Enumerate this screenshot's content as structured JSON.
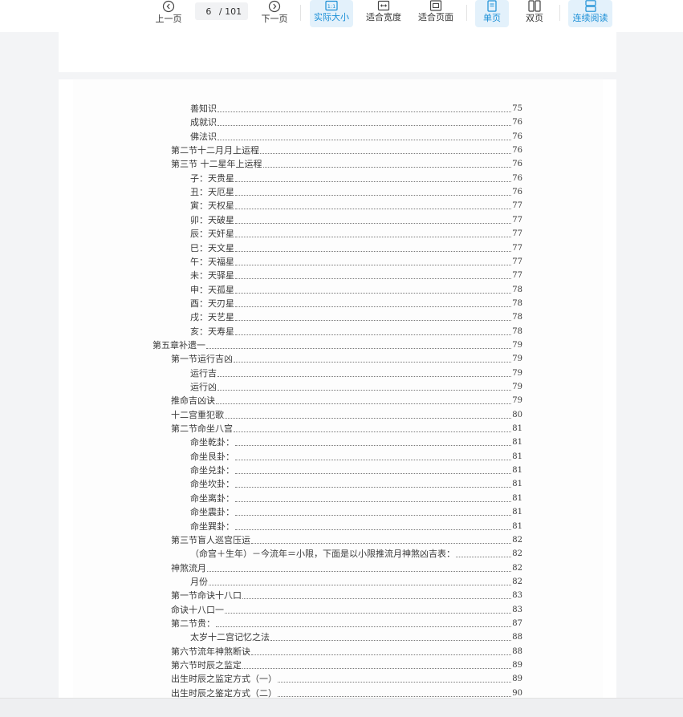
{
  "toolbar": {
    "prev_label": "上一页",
    "next_label": "下一页",
    "current_page": "6",
    "total_pages": "/ 101",
    "actual_size_label": "实际大小",
    "fit_width_label": "适合宽度",
    "fit_page_label": "适合页面",
    "single_page_label": "单页",
    "double_page_label": "双页",
    "continuous_label": "连续阅读",
    "accent_color": "#1b8fd6"
  },
  "toc": [
    {
      "title": "善知识",
      "page": "75",
      "level": 3
    },
    {
      "title": "成就识",
      "page": "76",
      "level": 3
    },
    {
      "title": "佛法识",
      "page": "76",
      "level": 3
    },
    {
      "title": "第二节十二月月上运程",
      "page": "76",
      "level": 2
    },
    {
      "title": "第三节 十二星年上运程",
      "page": "76",
      "level": 2
    },
    {
      "title": "子：天贵星",
      "page": "76",
      "level": 3
    },
    {
      "title": "丑：天厄星",
      "page": "76",
      "level": 3
    },
    {
      "title": "寅：天权星",
      "page": "77",
      "level": 3
    },
    {
      "title": "卯：天破星",
      "page": "77",
      "level": 3
    },
    {
      "title": "辰：天奸星",
      "page": "77",
      "level": 3
    },
    {
      "title": "巳：天文星",
      "page": "77",
      "level": 3
    },
    {
      "title": "午：天福星",
      "page": "77",
      "level": 3
    },
    {
      "title": "未：天驿星",
      "page": "77",
      "level": 3
    },
    {
      "title": "申：天孤星",
      "page": "78",
      "level": 3
    },
    {
      "title": "酉：天刃星",
      "page": "78",
      "level": 3
    },
    {
      "title": "戌：天艺星",
      "page": "78",
      "level": 3
    },
    {
      "title": "亥：天寿星",
      "page": "78",
      "level": 3
    },
    {
      "title": "第五章补遗一",
      "page": "79",
      "level": 1
    },
    {
      "title": "第一节运行吉凶",
      "page": "79",
      "level": 2
    },
    {
      "title": "运行吉",
      "page": "79",
      "level": 3
    },
    {
      "title": "运行凶",
      "page": "79",
      "level": 3
    },
    {
      "title": "推命吉凶诀",
      "page": "79",
      "level": 2
    },
    {
      "title": "十二宫重犯歌",
      "page": "80",
      "level": 2
    },
    {
      "title": "第二节命坐八宫",
      "page": "81",
      "level": 2
    },
    {
      "title": "命坐乾卦：",
      "page": "81",
      "level": 3
    },
    {
      "title": "命坐艮卦：",
      "page": "81",
      "level": 3
    },
    {
      "title": "命坐兑卦：",
      "page": "81",
      "level": 3
    },
    {
      "title": "命坐坎卦：",
      "page": "81",
      "level": 3
    },
    {
      "title": "命坐离卦：",
      "page": "81",
      "level": 3
    },
    {
      "title": "命坐震卦：",
      "page": "81",
      "level": 3
    },
    {
      "title": "命坐巽卦：",
      "page": "81",
      "level": 3
    },
    {
      "title": "第三节盲人巡宫压运",
      "page": "82",
      "level": 2
    },
    {
      "title": "（命宫＋生年）－今流年＝小限，下面是以小限推流月神煞凶吉表：",
      "page": "82",
      "level": 3
    },
    {
      "title": "神煞流月",
      "page": "82",
      "level": 2
    },
    {
      "title": "月份",
      "page": "82",
      "level": 3
    },
    {
      "title": "第一节命诀十八口",
      "page": "83",
      "level": 2
    },
    {
      "title": "命诀十八口一",
      "page": "83",
      "level": 2
    },
    {
      "title": "第二节贵：",
      "page": "87",
      "level": 2
    },
    {
      "title": "太岁十二宫记忆之法",
      "page": "88",
      "level": 3
    },
    {
      "title": "第六节流年神煞断诀",
      "page": "88",
      "level": 2
    },
    {
      "title": "第六节时辰之监定",
      "page": "89",
      "level": 2
    },
    {
      "title": "出生时辰之监定方式（一）",
      "page": "89",
      "level": 2
    },
    {
      "title": "出生时辰之鉴定方式（二）",
      "page": "90",
      "level": 2
    }
  ]
}
